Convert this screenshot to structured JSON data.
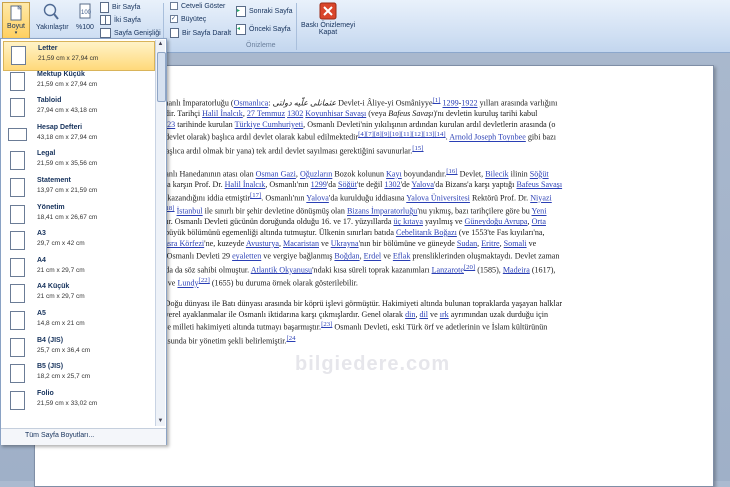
{
  "ribbon": {
    "boyut": "Boyut",
    "yakinlastir": "Yakınlaştır",
    "yuzde": "%100",
    "bir_sayfa": "Bir Sayfa",
    "iki_sayfa": "İki Sayfa",
    "sayfa_genisligi": "Sayfa Genişliği",
    "cetveli_goster": "Cetveli Göster",
    "buyutec": "Büyüteç",
    "bir_sayfa_daralt": "Bir Sayfa Daralt",
    "sonraki_sayfa": "Sonraki Sayfa",
    "onceki_sayfa": "Önceki Sayfa",
    "baski_kapat_1": "Baskı Önizlemeyi",
    "baski_kapat_2": "Kapat",
    "group_onizleme": "Önizleme"
  },
  "dropdown": {
    "items": [
      {
        "name": "Letter",
        "size": "21,59 cm x 27,94 cm",
        "selected": true,
        "orientation": "portrait"
      },
      {
        "name": "Mektup Küçük",
        "size": "21,59 cm x 27,94 cm",
        "orientation": "portrait"
      },
      {
        "name": "Tabloid",
        "size": "27,94 cm x 43,18 cm",
        "orientation": "portrait"
      },
      {
        "name": "Hesap Defteri",
        "size": "43,18 cm x 27,94 cm",
        "orientation": "landscape"
      },
      {
        "name": "Legal",
        "size": "21,59 cm x 35,56 cm",
        "orientation": "portrait"
      },
      {
        "name": "Statement",
        "size": "13,97 cm x 21,59 cm",
        "orientation": "portrait"
      },
      {
        "name": "Yönetim",
        "size": "18,41 cm x 26,67 cm",
        "orientation": "portrait"
      },
      {
        "name": "A3",
        "size": "29,7 cm x 42 cm",
        "orientation": "portrait"
      },
      {
        "name": "A4",
        "size": "21 cm x 29,7 cm",
        "orientation": "portrait"
      },
      {
        "name": "A4 Küçük",
        "size": "21 cm x 29,7 cm",
        "orientation": "portrait"
      },
      {
        "name": "A5",
        "size": "14,8 cm x 21 cm",
        "orientation": "portrait"
      },
      {
        "name": "B4 (JIS)",
        "size": "25,7 cm x 36,4 cm",
        "orientation": "portrait"
      },
      {
        "name": "B5 (JIS)",
        "size": "18,2 cm x 25,7 cm",
        "orientation": "portrait"
      },
      {
        "name": "Folio",
        "size": "21,59 cm x 33,02 cm",
        "orientation": "portrait"
      }
    ],
    "footer": "Tüm Sayfa Boyutları..."
  },
  "document": {
    "watermark": "bilgiedere.com"
  }
}
